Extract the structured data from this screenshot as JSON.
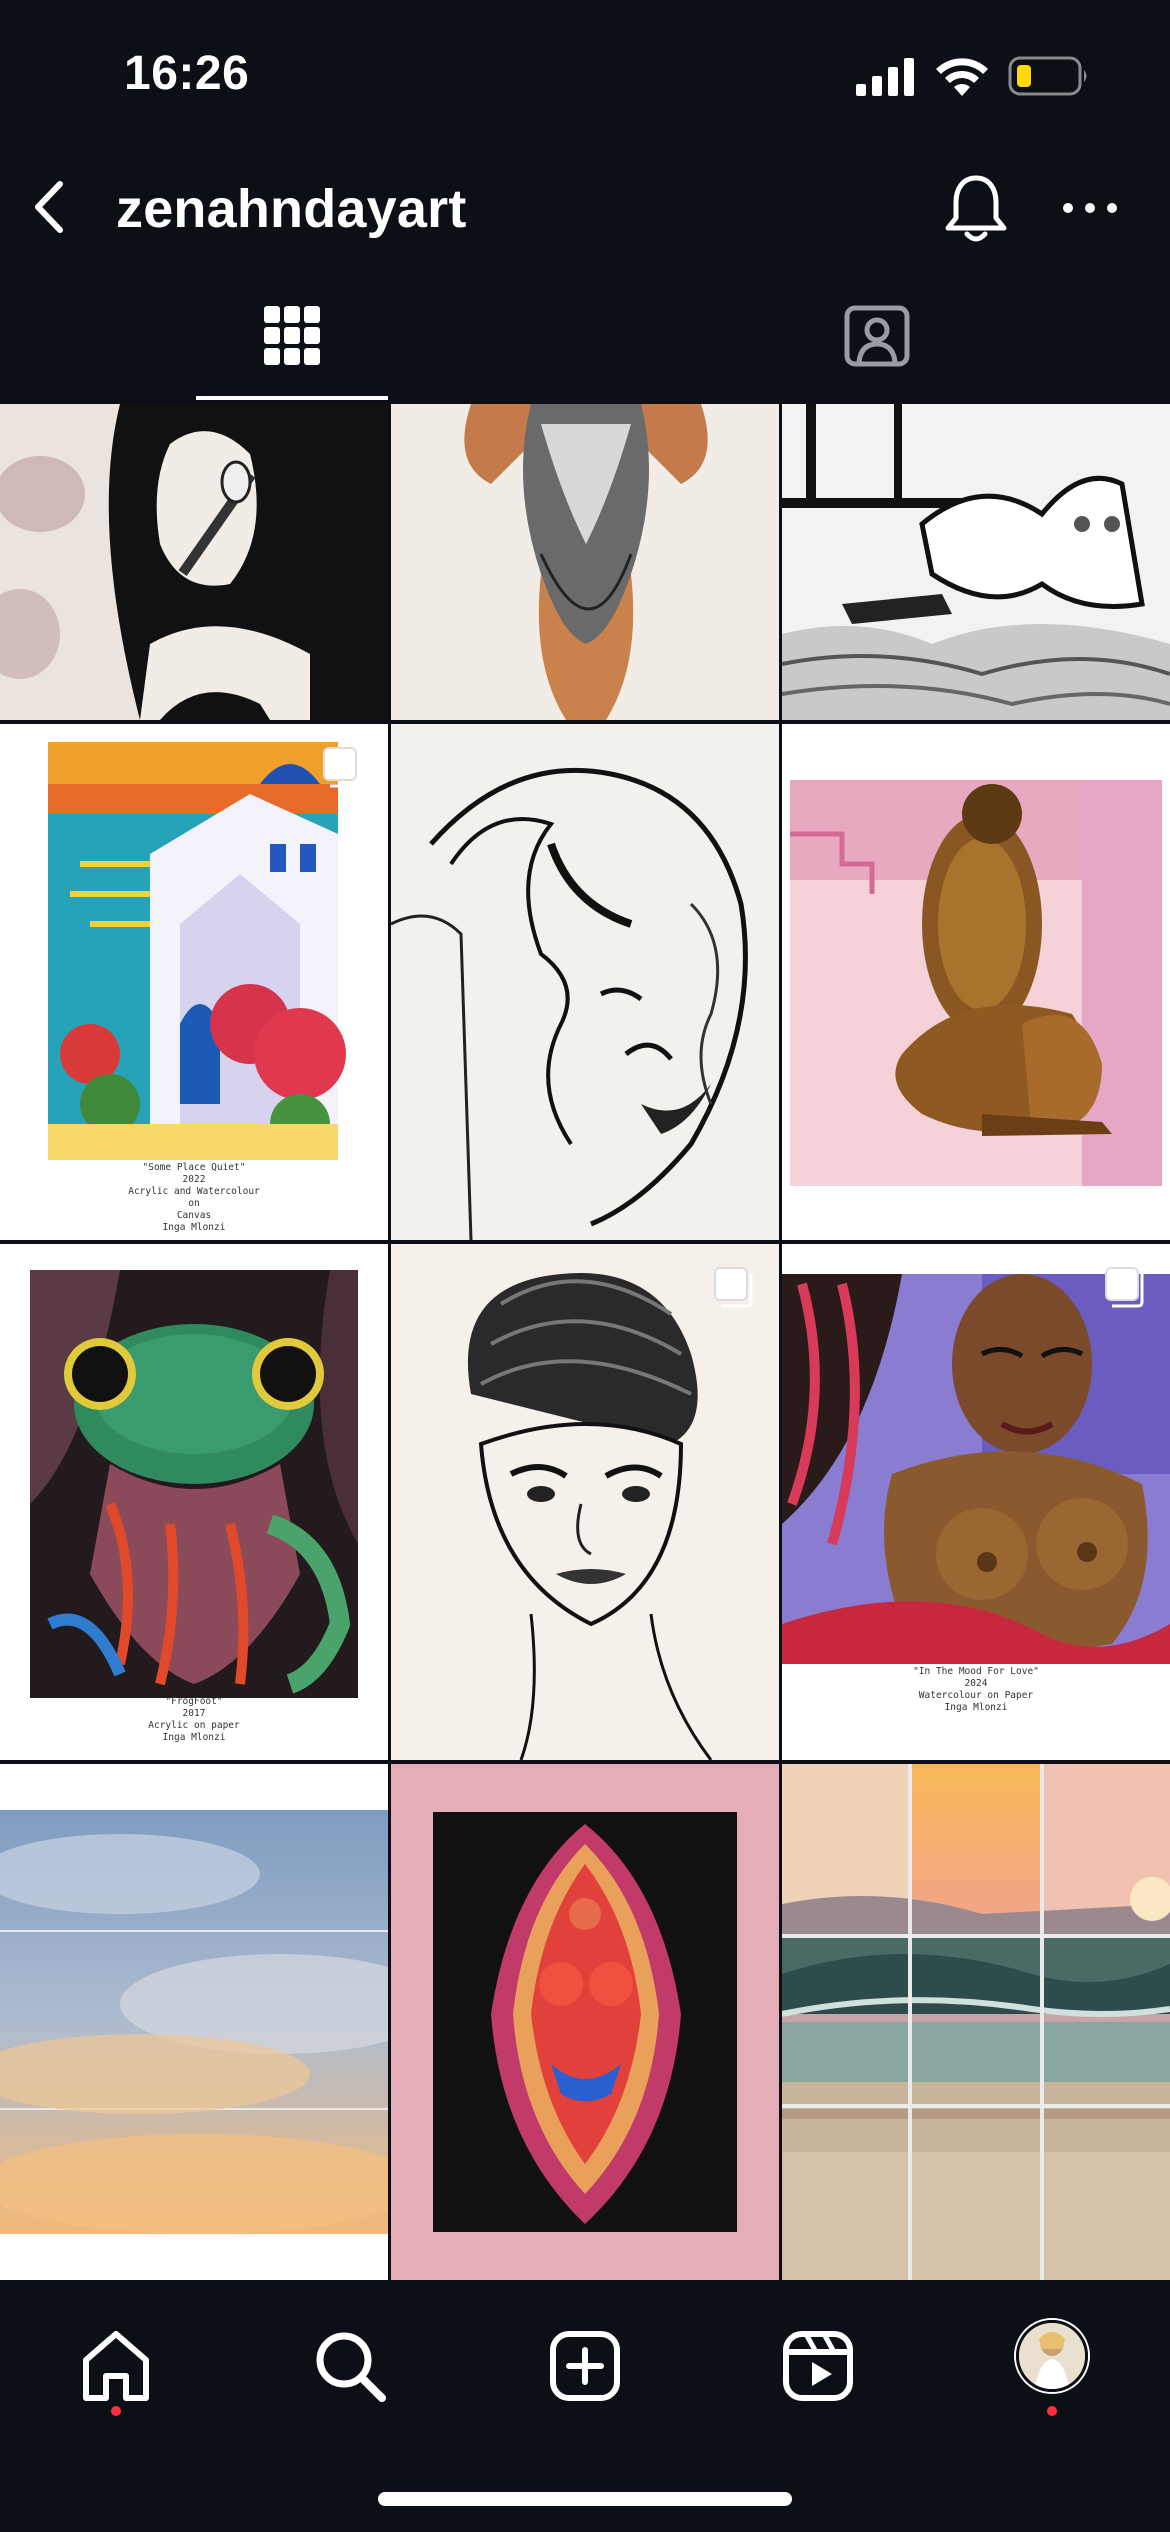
{
  "status_bar": {
    "time": "16:26"
  },
  "header": {
    "username": "zenahndayart"
  },
  "tabs": [
    {
      "name": "posts-grid",
      "icon": "grid-icon",
      "selected": true
    },
    {
      "name": "tagged",
      "icon": "tagged-user-icon",
      "selected": false
    }
  ],
  "posts": [
    {
      "id": 1,
      "multi": false
    },
    {
      "id": 2,
      "multi": false
    },
    {
      "id": 3,
      "multi": false
    },
    {
      "id": 4,
      "multi": true,
      "caption": [
        "\"Some Place Quiet\"",
        "2022",
        "Acrylic and Watercolour",
        "on",
        "Canvas",
        "Inga Mlonzi"
      ]
    },
    {
      "id": 5,
      "multi": false
    },
    {
      "id": 6,
      "multi": false
    },
    {
      "id": 7,
      "multi": false,
      "caption": [
        "\"FrogFoot\"",
        "2017",
        "Acrylic on paper",
        "Inga Mlonzi"
      ]
    },
    {
      "id": 8,
      "multi": true
    },
    {
      "id": 9,
      "multi": true,
      "caption": [
        "\"In The Mood For Love\"",
        "2024",
        "Watercolour on Paper",
        "Inga Mlonzi"
      ]
    },
    {
      "id": 10,
      "multi": false
    },
    {
      "id": 11,
      "multi": false
    },
    {
      "id": 12,
      "multi": false
    }
  ],
  "bottom_nav": [
    {
      "name": "home",
      "icon": "home-icon",
      "notification_dot": true
    },
    {
      "name": "search",
      "icon": "search-icon",
      "notification_dot": false
    },
    {
      "name": "create",
      "icon": "plus-square-icon",
      "notification_dot": false
    },
    {
      "name": "reels",
      "icon": "reels-icon",
      "notification_dot": false
    },
    {
      "name": "profile",
      "icon": "avatar",
      "notification_dot": true
    }
  ],
  "colors": {
    "background": "#0c0f16",
    "text": "#ffffff",
    "notification": "#ff3040",
    "battery_low": "#ffd60a"
  }
}
